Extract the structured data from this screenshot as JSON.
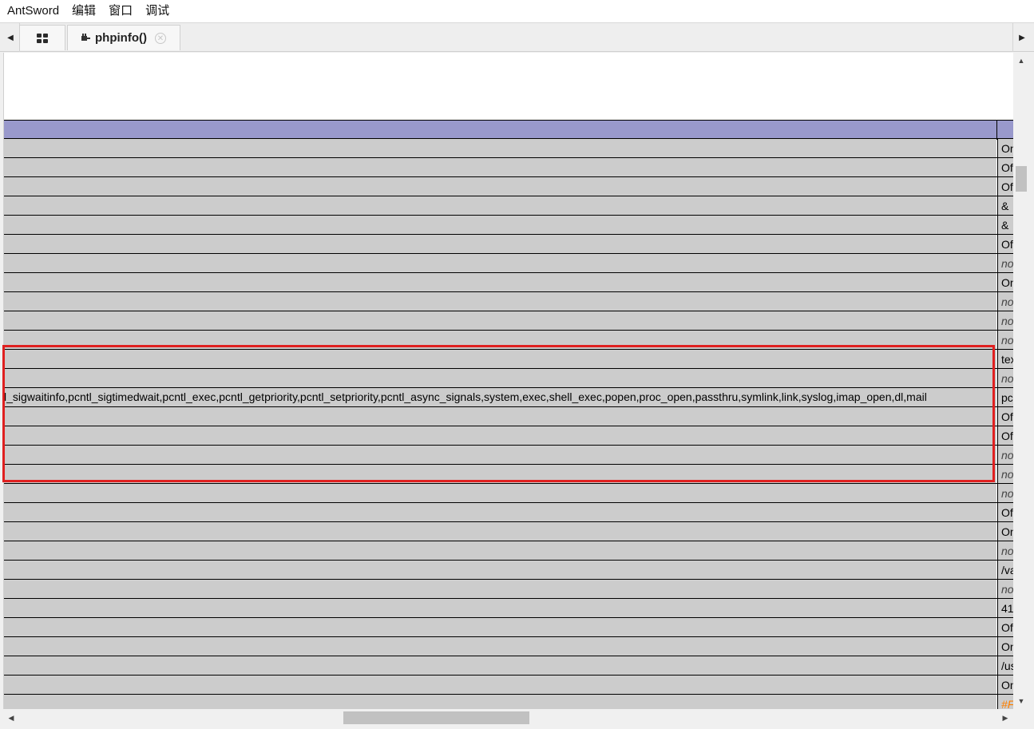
{
  "menubar": {
    "items": [
      "AntSword",
      "编辑",
      "窗口",
      "调试"
    ]
  },
  "tabs": {
    "scroll_left": "◀",
    "scroll_right": "▶",
    "php_tab": {
      "icon": "plugin-icon",
      "label": "phpinfo()",
      "close": "✕"
    }
  },
  "table": {
    "rows": [
      {
        "key": "",
        "value": "On",
        "style": "normal"
      },
      {
        "key": "",
        "value": "Off",
        "style": "normal"
      },
      {
        "key": "",
        "value": "Off",
        "style": "normal"
      },
      {
        "key": "",
        "value": "&",
        "style": "normal"
      },
      {
        "key": "",
        "value": "&",
        "style": "normal"
      },
      {
        "key": "",
        "value": "Off",
        "style": "normal"
      },
      {
        "key": "",
        "value": "no",
        "style": "italic"
      },
      {
        "key": "",
        "value": "On",
        "style": "normal"
      },
      {
        "key": "",
        "value": "no",
        "style": "italic"
      },
      {
        "key": "",
        "value": "no",
        "style": "italic"
      },
      {
        "key": "",
        "value": "no",
        "style": "italic"
      },
      {
        "key": "",
        "value": "tex",
        "style": "normal"
      },
      {
        "key": "",
        "value": "no",
        "style": "italic"
      },
      {
        "key": "l_sigwaitinfo,pcntl_sigtimedwait,pcntl_exec,pcntl_getpriority,pcntl_setpriority,pcntl_async_signals,system,exec,shell_exec,popen,proc_open,passthru,symlink,link,syslog,imap_open,dl,mail",
        "value": "pc",
        "style": "normal"
      },
      {
        "key": "",
        "value": "Off",
        "style": "normal"
      },
      {
        "key": "",
        "value": "Off",
        "style": "normal"
      },
      {
        "key": "",
        "value": "no",
        "style": "italic"
      },
      {
        "key": "",
        "value": "no",
        "style": "italic"
      },
      {
        "key": "",
        "value": "no",
        "style": "italic"
      },
      {
        "key": "",
        "value": "Off",
        "style": "normal"
      },
      {
        "key": "",
        "value": "On",
        "style": "normal"
      },
      {
        "key": "",
        "value": "no",
        "style": "italic"
      },
      {
        "key": "",
        "value": "/va",
        "style": "normal"
      },
      {
        "key": "",
        "value": "no",
        "style": "italic"
      },
      {
        "key": "",
        "value": "41",
        "style": "normal"
      },
      {
        "key": "",
        "value": "Off",
        "style": "normal"
      },
      {
        "key": "",
        "value": "On",
        "style": "normal"
      },
      {
        "key": "",
        "value": "/us",
        "style": "normal"
      },
      {
        "key": "",
        "value": "On",
        "style": "normal"
      },
      {
        "key": "",
        "value": "#F",
        "style": "orange"
      }
    ]
  },
  "colors": {
    "header_row": "#9999cc",
    "row_bg": "#cccccc",
    "highlight": "#e02020",
    "orange_value": "#ff8000"
  },
  "scrollbars": {
    "up": "▲",
    "down": "▼",
    "left": "◀",
    "right": "▶"
  }
}
